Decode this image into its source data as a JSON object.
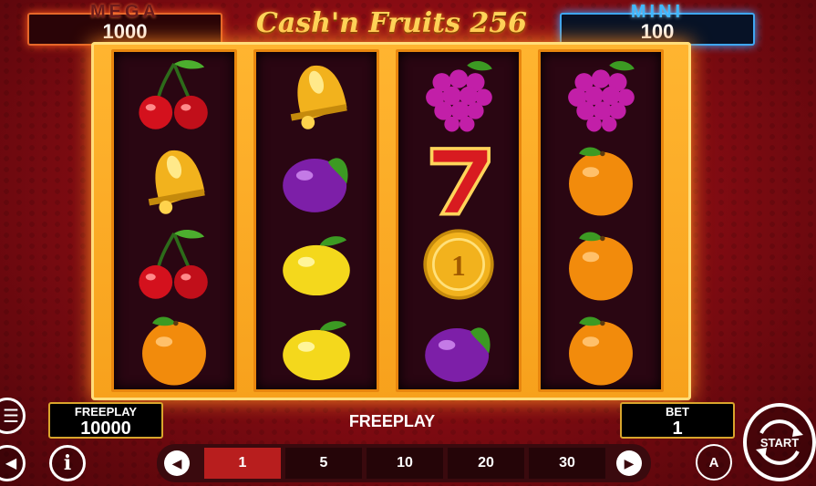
{
  "title": "Cash'n Fruits 256",
  "jackpots": {
    "mega": {
      "label": "MEGA",
      "value": "1000"
    },
    "mini": {
      "label": "MINI",
      "value": "100"
    }
  },
  "reels": [
    [
      "cherries",
      "bell",
      "cherries",
      "orange"
    ],
    [
      "bell",
      "plum",
      "lemon",
      "lemon"
    ],
    [
      "grapes",
      "seven",
      "coin",
      "plum"
    ],
    [
      "grapes",
      "orange",
      "orange",
      "orange"
    ]
  ],
  "coin_value": "1",
  "freeplay_panel": {
    "label": "FREEPLAY",
    "value": "10000"
  },
  "bet_panel": {
    "label": "BET",
    "value": "1"
  },
  "status_text": "FREEPLAY",
  "bet_options": [
    "1",
    "5",
    "10",
    "20",
    "30"
  ],
  "selected_bet_index": 0,
  "start_label": "START",
  "autoplay_label": "A",
  "info_label": "i",
  "colors": {
    "accent": "#f7a11c",
    "active_bet": "#b81e1e",
    "mini": "#3fa6f2",
    "mega": "#e6672a"
  }
}
